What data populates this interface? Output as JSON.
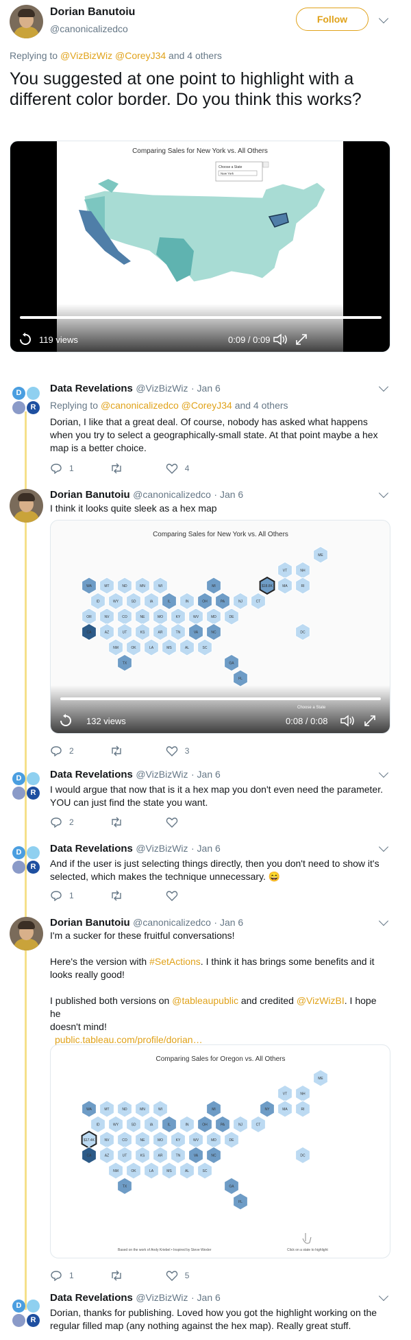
{
  "main_tweet": {
    "author_name": "Dorian Banutoiu",
    "author_handle": "@canonicalizedco",
    "follow_label": "Follow",
    "replying_prefix": "Replying to",
    "replying_mentions": "@VizBizWiz @CoreyJ34",
    "replying_suffix": "and 4 others",
    "text": "You suggested at one point to highlight with a different color border. Do you think this works?",
    "video": {
      "chart_title": "Comparing Sales for New York vs. All Others",
      "selector_label": "Choose a State",
      "selector_value": "New York",
      "views": "119 views",
      "time": "0:09 / 0:09"
    }
  },
  "replies": [
    {
      "author_name": "Data Revelations",
      "author_handle": "@VizBizWiz",
      "date": "· Jan 6",
      "replying_prefix": "Replying to",
      "replying_mentions": "@canonicalizedco @CoreyJ34",
      "replying_suffix": "and 4 others",
      "lines": [
        "Dorian, I like that a great deal.  Of course, nobody has asked what happens",
        "when you try to select a geographically-small state. At that point maybe a hex",
        "map is a better choice."
      ],
      "replies": "1",
      "likes": "4"
    },
    {
      "author_name": "Dorian Banutoiu",
      "author_handle": "@canonicalizedco",
      "date": "· Jan 6",
      "lines": [
        "I think it looks quite sleek as a hex map"
      ],
      "media": {
        "chart_title": "Comparing Sales for New York vs. All Others",
        "selected_label": "$18.8K",
        "selector_label": "Choose a State",
        "views": "132 views",
        "time": "0:08 / 0:08"
      },
      "replies": "2",
      "likes": "3"
    },
    {
      "author_name": "Data Revelations",
      "author_handle": "@VizBizWiz",
      "date": "· Jan 6",
      "lines": [
        "I would argue that now that is it a hex map you don't even need the parameter.",
        "YOU can just find the state you want."
      ],
      "replies": "2",
      "likes": ""
    },
    {
      "author_name": "Data Revelations",
      "author_handle": "@VizBizWiz",
      "date": "· Jan 6",
      "lines": [
        "And if the user is just selecting things directly, then you don't need to show it's",
        "selected, which makes the technique unnecessary. 😄"
      ],
      "replies": "1",
      "likes": ""
    },
    {
      "author_name": "Dorian Banutoiu",
      "author_handle": "@canonicalizedco",
      "date": "· Jan 6",
      "line1": "I'm a sucker for these fruitful conversations!",
      "line2a": "Here's the version with ",
      "hashtag": "#SetActions",
      "line2b": ". I think it has brings some benefits and it",
      "line2c": "looks really good!",
      "line3a": "I published both versions on ",
      "mention1": "@tableaupublic",
      "line3b": " and credited ",
      "mention2": "@VizWizBI",
      "line3c": ". I hope he",
      "line3d": "doesn't mind!",
      "link": "public.tableau.com/profile/dorian…",
      "media": {
        "chart_title": "Comparing Sales for Oregon vs. All Others",
        "selected_label": "$17.4K",
        "selected_state": "OR",
        "footer_left": "Based on the work of Andy Kriebel • Inspired by Steve Wexler",
        "footer_right": "Click on a state to highlight"
      },
      "replies": "1",
      "likes": "5"
    },
    {
      "author_name": "Data Revelations",
      "author_handle": "@VizBizWiz",
      "date": "· Jan 6",
      "lines": [
        "Dorian, thanks for publishing.  Loved how you got the highlight working on the",
        "regular filled map (any nothing against the hex map).  Really great stuff."
      ]
    }
  ],
  "hex_states": [
    [
      "ME"
    ],
    [
      "VT",
      "NH"
    ],
    [
      "WA",
      "MT",
      "ND",
      "MN",
      "WI",
      "MI",
      "NY",
      "MA",
      "RI"
    ],
    [
      "ID",
      "WY",
      "SD",
      "IA",
      "IL",
      "IN",
      "OH",
      "PA",
      "NJ",
      "CT"
    ],
    [
      "OR",
      "NV",
      "CO",
      "NE",
      "MO",
      "KY",
      "WV",
      "MD",
      "DE"
    ],
    [
      "CA",
      "AZ",
      "UT",
      "KS",
      "AR",
      "TN",
      "VA",
      "NC",
      "DC"
    ],
    [
      "NM",
      "OK",
      "LA",
      "MS",
      "AL",
      "SC"
    ],
    [
      "TX",
      "GA"
    ],
    [
      "FL"
    ]
  ],
  "colors": {
    "accent": "#e0a21a",
    "hex_light": "#bcdaf2",
    "hex_mid": "#6e9cc6",
    "hex_dark": "#2c5a87"
  }
}
